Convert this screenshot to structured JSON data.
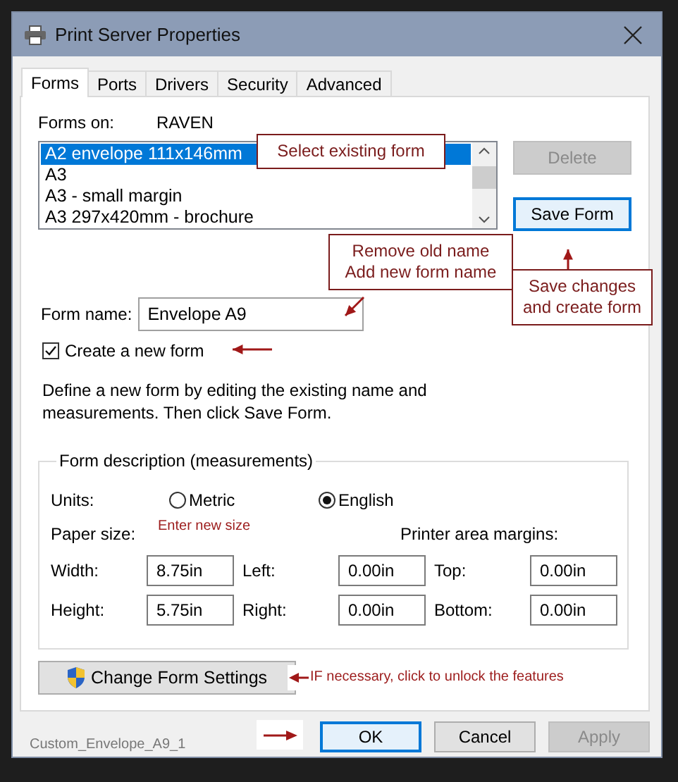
{
  "window": {
    "title": "Print Server Properties"
  },
  "tabs": [
    {
      "label": "Forms",
      "selected": true
    },
    {
      "label": "Ports",
      "selected": false
    },
    {
      "label": "Drivers",
      "selected": false
    },
    {
      "label": "Security",
      "selected": false
    },
    {
      "label": "Advanced",
      "selected": false
    }
  ],
  "forms_on": {
    "label": "Forms on:",
    "server": "RAVEN"
  },
  "forms_list": [
    {
      "name": "A2 envelope 111x146mm",
      "selected": true
    },
    {
      "name": "A3",
      "selected": false
    },
    {
      "name": "A3 - small margin",
      "selected": false
    },
    {
      "name": "A3 297x420mm - brochure",
      "selected": false
    }
  ],
  "side_buttons": [
    {
      "label": "Delete",
      "disabled": true,
      "default": false
    },
    {
      "label": "Save Form",
      "disabled": false,
      "default": true
    }
  ],
  "form_name": {
    "label": "Form name:",
    "value": "Envelope A9"
  },
  "create_new": {
    "label": "Create a new form",
    "checked": true
  },
  "hint": "Define a new form by editing the existing name and measurements. Then click Save Form.",
  "group": {
    "legend": "Form description (measurements)",
    "units_label": "Units:",
    "units": [
      {
        "label": "Metric",
        "selected": false
      },
      {
        "label": "English",
        "selected": true
      }
    ],
    "paper_size_label": "Paper size:",
    "margins_label": "Printer area margins:",
    "rows": [
      [
        {
          "label": "Width:",
          "value": "8.75in"
        },
        {
          "label": "Left:",
          "value": "0.00in"
        },
        {
          "label": "Top:",
          "value": "0.00in"
        }
      ],
      [
        {
          "label": "Height:",
          "value": "5.75in"
        },
        {
          "label": "Right:",
          "value": "0.00in"
        },
        {
          "label": "Bottom:",
          "value": "0.00in"
        }
      ]
    ]
  },
  "change_settings": {
    "label": "Change Form Settings"
  },
  "footer": {
    "file_name": "Custom_Envelope_A9_1",
    "buttons": [
      {
        "label": "OK",
        "disabled": false,
        "default": true
      },
      {
        "label": "Cancel",
        "disabled": false,
        "default": false
      },
      {
        "label": "Apply",
        "disabled": true,
        "default": false
      }
    ]
  },
  "annotations": [
    {
      "kind": "callout",
      "lines": [
        "Select existing form"
      ]
    },
    {
      "kind": "callout",
      "lines": [
        "Remove old name",
        "Add new form name"
      ]
    },
    {
      "kind": "callout",
      "lines": [
        "Save changes",
        "and create form"
      ]
    },
    {
      "kind": "note",
      "lines": [
        "Enter new size"
      ]
    },
    {
      "kind": "note",
      "lines": [
        "IF necessary, click to unlock the features"
      ]
    }
  ]
}
